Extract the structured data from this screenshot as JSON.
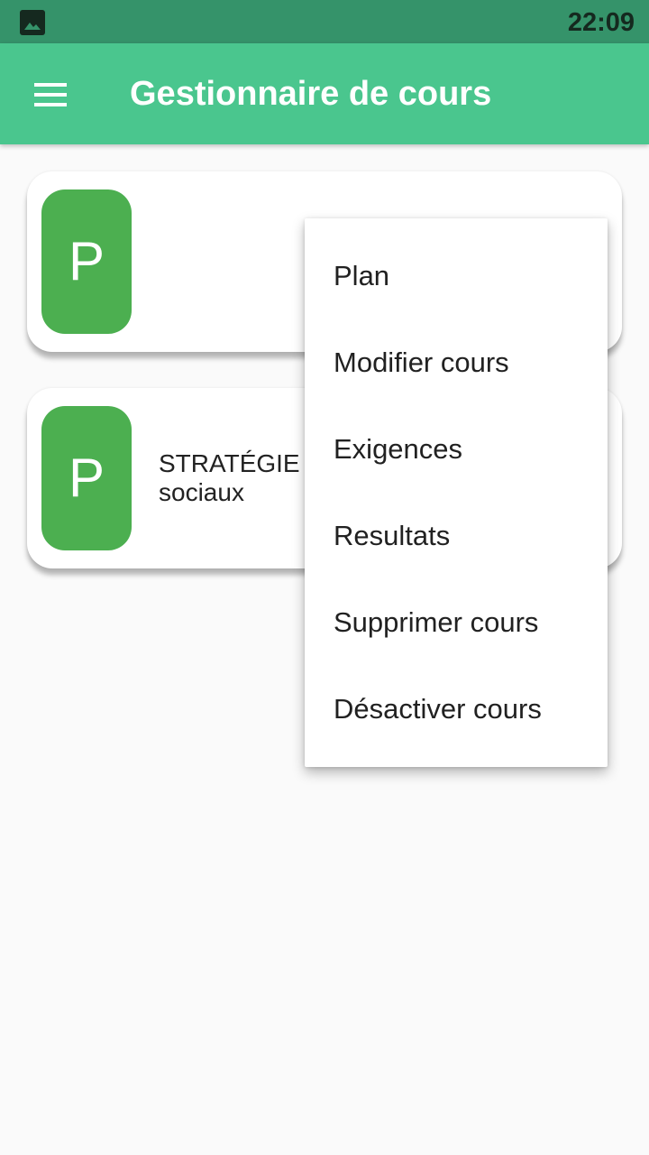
{
  "status_bar": {
    "time": "22:09",
    "icons": [
      "image-icon"
    ]
  },
  "app_bar": {
    "title": "Gestionnaire de cours",
    "menu_icon": "hamburger-menu-icon"
  },
  "courses": [
    {
      "avatar_letter": "P",
      "title": ""
    },
    {
      "avatar_letter": "P",
      "title": "STRATÉGIE marketing sur les médias sociaux"
    }
  ],
  "popup_menu": {
    "items": [
      {
        "label": "Plan"
      },
      {
        "label": "Modifier cours"
      },
      {
        "label": "Exigences"
      },
      {
        "label": "Resultats"
      },
      {
        "label": "Supprimer cours"
      },
      {
        "label": "Désactiver cours"
      }
    ]
  },
  "colors": {
    "status_bar": "#35936a",
    "app_bar": "#4ac68e",
    "avatar": "#4caf50",
    "background": "#fafafa"
  }
}
